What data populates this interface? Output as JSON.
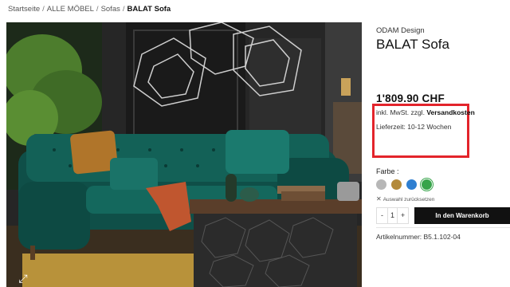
{
  "breadcrumb": {
    "items": [
      "Startseite",
      "ALLE MÖBEL",
      "Sofas"
    ],
    "current": "BALAT Sofa",
    "separator": "/"
  },
  "product": {
    "brand": "ODAM Design",
    "title": "BALAT Sofa",
    "price": "1'809.90 CHF",
    "tax_note_prefix": "inkl. MwSt. zzgl.",
    "tax_note_link": "Versandkosten",
    "delivery": "Lieferzeit: 10-12 Wochen",
    "color_label": "Farbe :",
    "swatches": [
      {
        "name": "grey",
        "color": "#b7b7b7"
      },
      {
        "name": "gold",
        "color": "#b38a3b"
      },
      {
        "name": "blue",
        "color": "#2f7fd1"
      },
      {
        "name": "green",
        "color": "#37a44a",
        "selected": true
      }
    ],
    "reset_label": "Auswahl zurücksetzen",
    "quantity": {
      "minus": "-",
      "value": "1",
      "plus": "+"
    },
    "add_to_cart": "In den Warenkorb",
    "sku": "Artikelnummer: B5.1.102-04"
  },
  "highlight_color": "#e3242b",
  "icons": {
    "zoom": "expand-icon",
    "reset": "close-icon"
  }
}
